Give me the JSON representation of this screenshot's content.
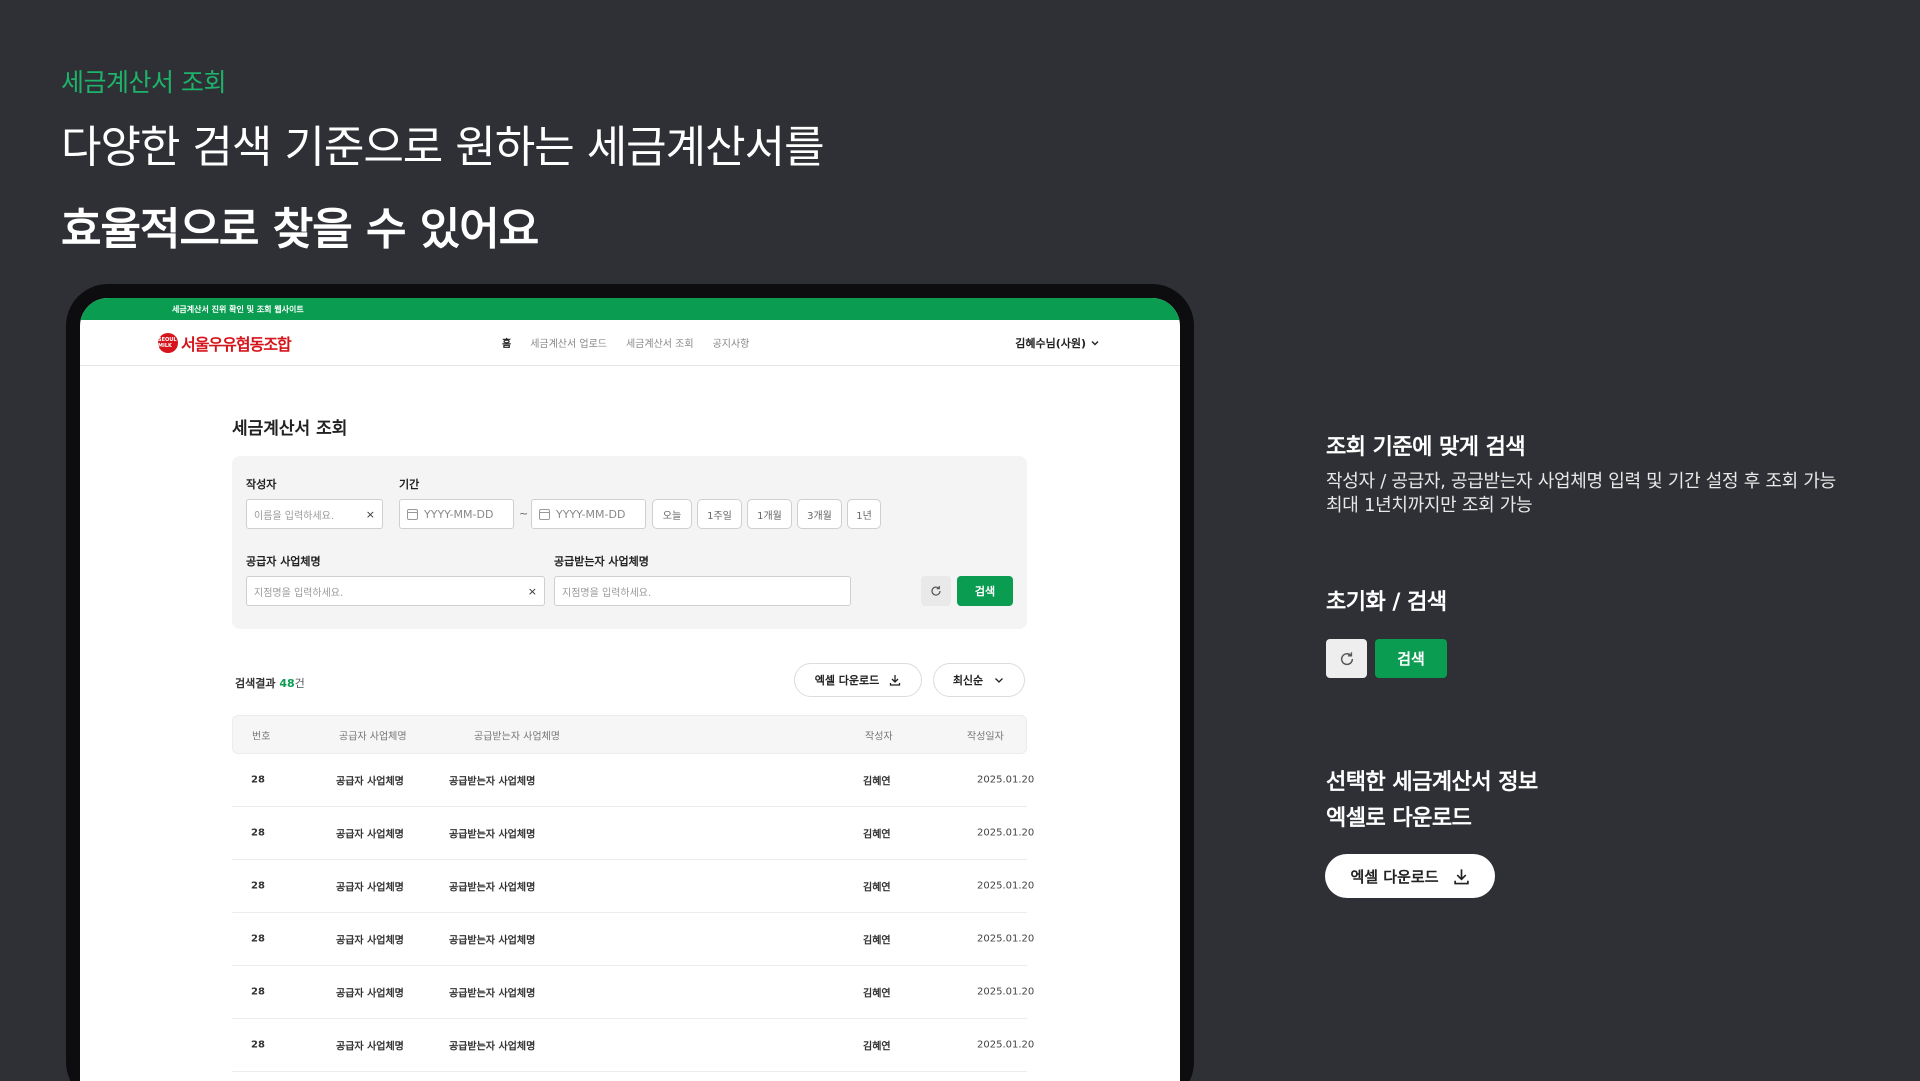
{
  "hero": {
    "eyebrow": "세금계산서 조회",
    "line1": "다양한 검색 기준으로 원하는 세금계산서를",
    "line2": "효율적으로 찾을 수 있어요"
  },
  "app": {
    "topbar_text": "세금계산서 진위 확인 및 조회 웹사이트",
    "logo_text": "서울우유협동조합",
    "logo_mark": "SEOUL MILK",
    "menu": [
      "홈",
      "세금계산서 업로드",
      "세금계산서 조회",
      "공지사항"
    ],
    "user_label": "김혜수님(사원)",
    "page_title": "세금계산서 조회",
    "filter": {
      "author_label": "작성자",
      "author_placeholder": "이름을 입력하세요.",
      "period_label": "기간",
      "date_placeholder": "YYYY-MM-DD",
      "tilde": "~",
      "quick_ranges": [
        "오늘",
        "1주일",
        "1개월",
        "3개월",
        "1년"
      ],
      "supplier_label": "공급자 사업체명",
      "supplier_placeholder": "지점명을 입력하세요.",
      "receiver_label": "공급받는자 사업체명",
      "receiver_placeholder": "지점명을 입력하세요.",
      "clear_glyph": "×",
      "search_label": "검색"
    },
    "results": {
      "prefix": "검색결과",
      "count": "48",
      "unit": "건",
      "excel_label": "엑셀 다운로드",
      "sort_label": "최신순"
    },
    "table": {
      "headers": [
        "번호",
        "공급자 사업체명",
        "공급받는자 사업체명",
        "작성자",
        "작성일자"
      ],
      "rows": [
        [
          "28",
          "공급자 사업체명",
          "공급받는자 사업체명",
          "김혜연",
          "2025.01.20"
        ],
        [
          "28",
          "공급자 사업체명",
          "공급받는자 사업체명",
          "김혜연",
          "2025.01.20"
        ],
        [
          "28",
          "공급자 사업체명",
          "공급받는자 사업체명",
          "김혜연",
          "2025.01.20"
        ],
        [
          "28",
          "공급자 사업체명",
          "공급받는자 사업체명",
          "김혜연",
          "2025.01.20"
        ],
        [
          "28",
          "공급자 사업체명",
          "공급받는자 사업체명",
          "김혜연",
          "2025.01.20"
        ],
        [
          "28",
          "공급자 사업체명",
          "공급받는자 사업체명",
          "김혜연",
          "2025.01.20"
        ]
      ]
    }
  },
  "panel": {
    "s1_title": "조회 기준에 맞게 검색",
    "s1_line1": "작성자 / 공급자, 공급받는자 사업체명 입력 및 기간 설정 후 조회 가능",
    "s1_line2": "최대 1년치까지만 조회 가능",
    "s2_title": "초기화 / 검색",
    "s2_search": "검색",
    "s3_title1": "선택한 세금계산서 정보",
    "s3_title2": "엑셀로 다운로드",
    "s3_excel": "엑셀 다운로드"
  },
  "icons": {
    "reset": "refresh-icon",
    "download": "download-icon",
    "chevron": "chevron-down-icon",
    "calendar": "calendar-icon"
  },
  "colors": {
    "background": "#2f3035",
    "accent_green": "#0a9d52",
    "hero_green": "#1db36a",
    "logo_red": "#d6141b"
  }
}
